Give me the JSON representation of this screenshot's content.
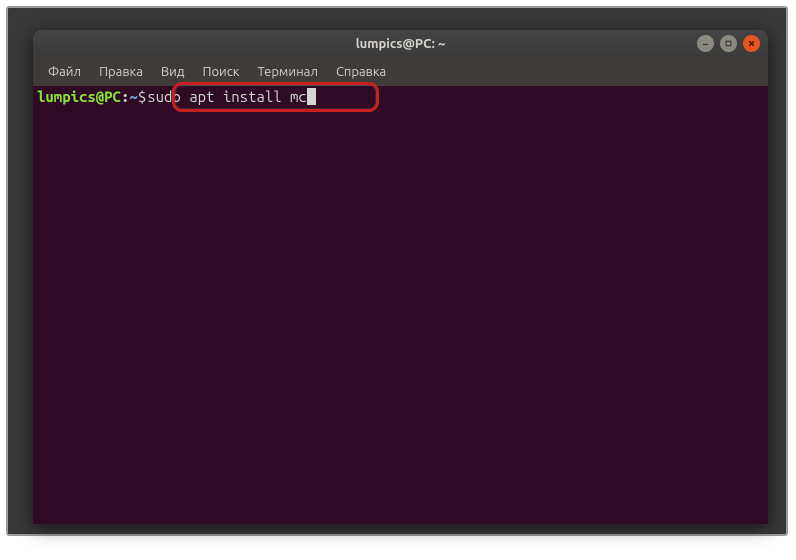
{
  "window": {
    "title": "lumpics@PC: ~"
  },
  "menubar": {
    "items": [
      {
        "label": "Файл"
      },
      {
        "label": "Правка"
      },
      {
        "label": "Вид"
      },
      {
        "label": "Поиск"
      },
      {
        "label": "Терминал"
      },
      {
        "label": "Справка"
      }
    ]
  },
  "terminal": {
    "prompt_user": "lumpics@PC",
    "prompt_colon": ":",
    "prompt_path": "~",
    "prompt_dollar": "$",
    "command": "sudo apt install mc"
  }
}
